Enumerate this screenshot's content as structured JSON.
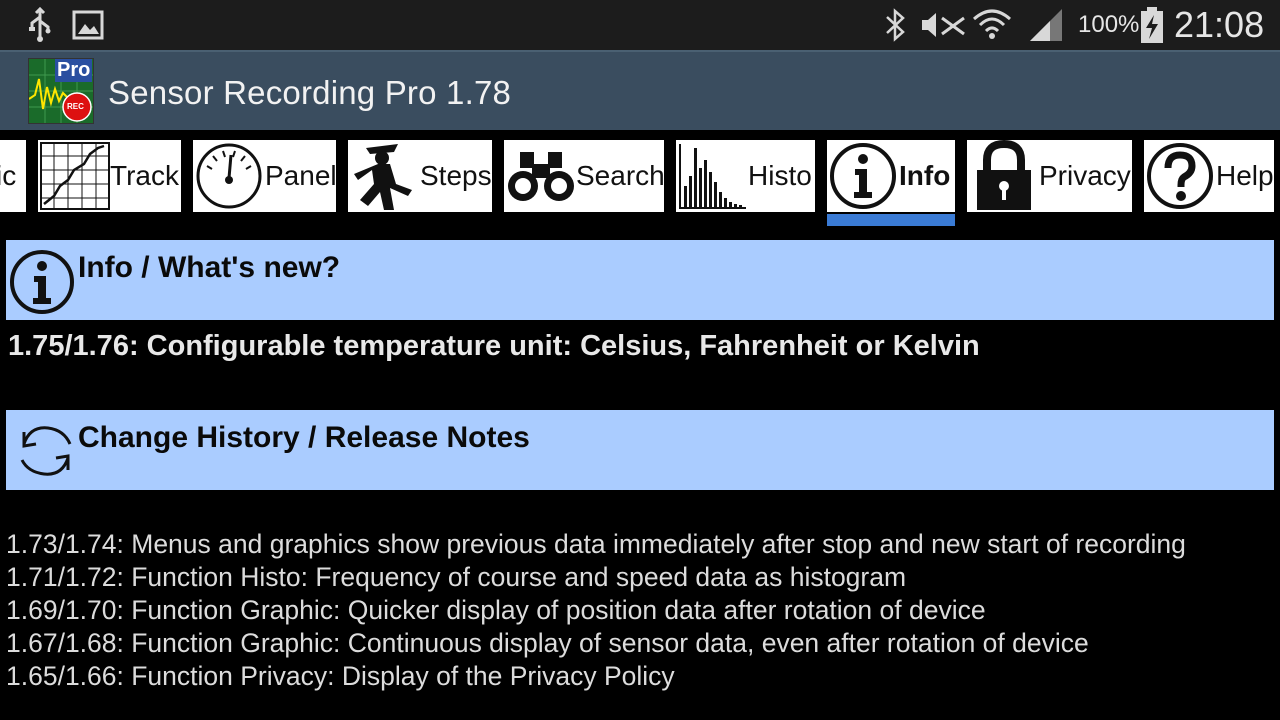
{
  "status_bar": {
    "icons": [
      "usb-icon",
      "image-icon",
      "bluetooth-icon",
      "mute-icon",
      "wifi-icon",
      "signal-icon",
      "battery-charging-icon"
    ],
    "battery": "100%",
    "time": "21:08"
  },
  "app": {
    "logo_text": "Pro",
    "logo_badge": "REC",
    "title": "Sensor Recording Pro 1.78"
  },
  "tabs": [
    {
      "id": "graphic",
      "label": "ic",
      "icon": "graphic-icon"
    },
    {
      "id": "track",
      "label": "Track",
      "icon": "track-map-icon"
    },
    {
      "id": "panel",
      "label": "Panel",
      "icon": "gauge-icon"
    },
    {
      "id": "steps",
      "label": "Steps",
      "icon": "walking-man-icon"
    },
    {
      "id": "search",
      "label": "Search",
      "icon": "binoculars-icon"
    },
    {
      "id": "histo",
      "label": "Histo",
      "icon": "histogram-icon"
    },
    {
      "id": "info",
      "label": "Info",
      "icon": "info-icon",
      "active": true
    },
    {
      "id": "privacy",
      "label": "Privacy",
      "icon": "padlock-icon"
    },
    {
      "id": "help",
      "label": "Help",
      "icon": "question-icon"
    }
  ],
  "info_section": {
    "title": "Info / What's new?",
    "latest": "1.75/1.76: Configurable temperature unit: Celsius, Fahrenheit or Kelvin"
  },
  "history_section": {
    "title": "Change History / Release Notes",
    "entries": [
      " 1.73/1.74: Menus and graphics show previous data immediately after stop and new start of recording",
      " 1.71/1.72: Function Histo: Frequency of course and speed data as histogram",
      " 1.69/1.70: Function Graphic: Quicker display of position data after rotation of device",
      " 1.67/1.68: Function Graphic: Continuous display of sensor data, even after rotation of device",
      " 1.65/1.66: Function Privacy: Display of the Privacy Policy"
    ]
  },
  "colors": {
    "status_bar": "#1c1c1c",
    "action_bar": "#3a4d5f",
    "section_header": "#aaccff",
    "tab_indicator": "#3a7bd5"
  }
}
